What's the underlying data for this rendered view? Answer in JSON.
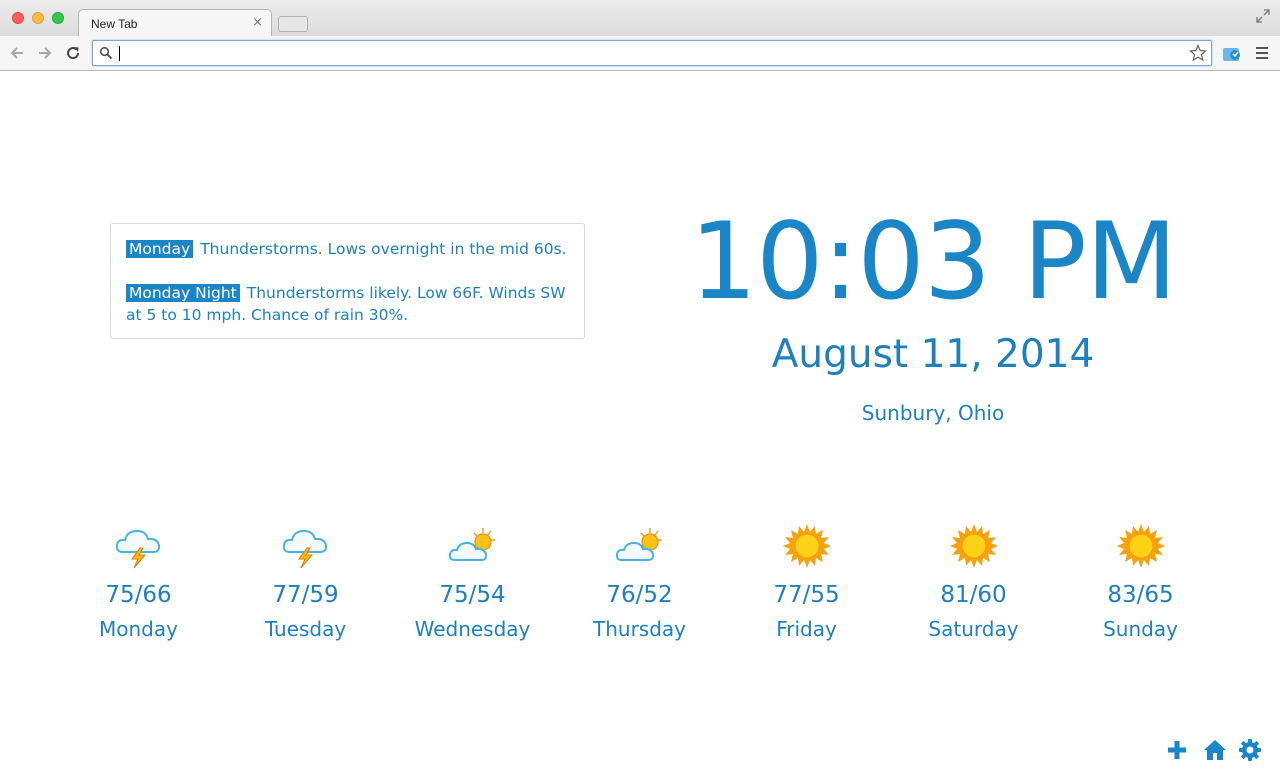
{
  "window": {
    "tab_title": "New Tab",
    "tab_close": "×"
  },
  "toolbar": {
    "address_value": "",
    "address_placeholder": ""
  },
  "forecast": [
    {
      "label": "Monday",
      "text": "Thunderstorms. Lows overnight in the mid 60s."
    },
    {
      "label": "Monday Night",
      "text": "Thunderstorms likely. Low 66F. Winds SW at 5 to 10 mph. Chance of rain 30%."
    }
  ],
  "clock": {
    "time": "10:03 PM",
    "date": "August 11, 2014",
    "location": "Sunbury, Ohio"
  },
  "days": [
    {
      "temp": "75/66",
      "name": "Monday",
      "icon": "thunderstorm-icon"
    },
    {
      "temp": "77/59",
      "name": "Tuesday",
      "icon": "thunderstorm-icon"
    },
    {
      "temp": "75/54",
      "name": "Wednesday",
      "icon": "partly-cloudy-icon"
    },
    {
      "temp": "76/52",
      "name": "Thursday",
      "icon": "partly-cloudy-icon"
    },
    {
      "temp": "77/55",
      "name": "Friday",
      "icon": "sunny-icon"
    },
    {
      "temp": "81/60",
      "name": "Saturday",
      "icon": "sunny-icon"
    },
    {
      "temp": "83/65",
      "name": "Sunday",
      "icon": "sunny-icon"
    }
  ],
  "colors": {
    "accent": "#1a85c7",
    "text": "#1f80be"
  }
}
